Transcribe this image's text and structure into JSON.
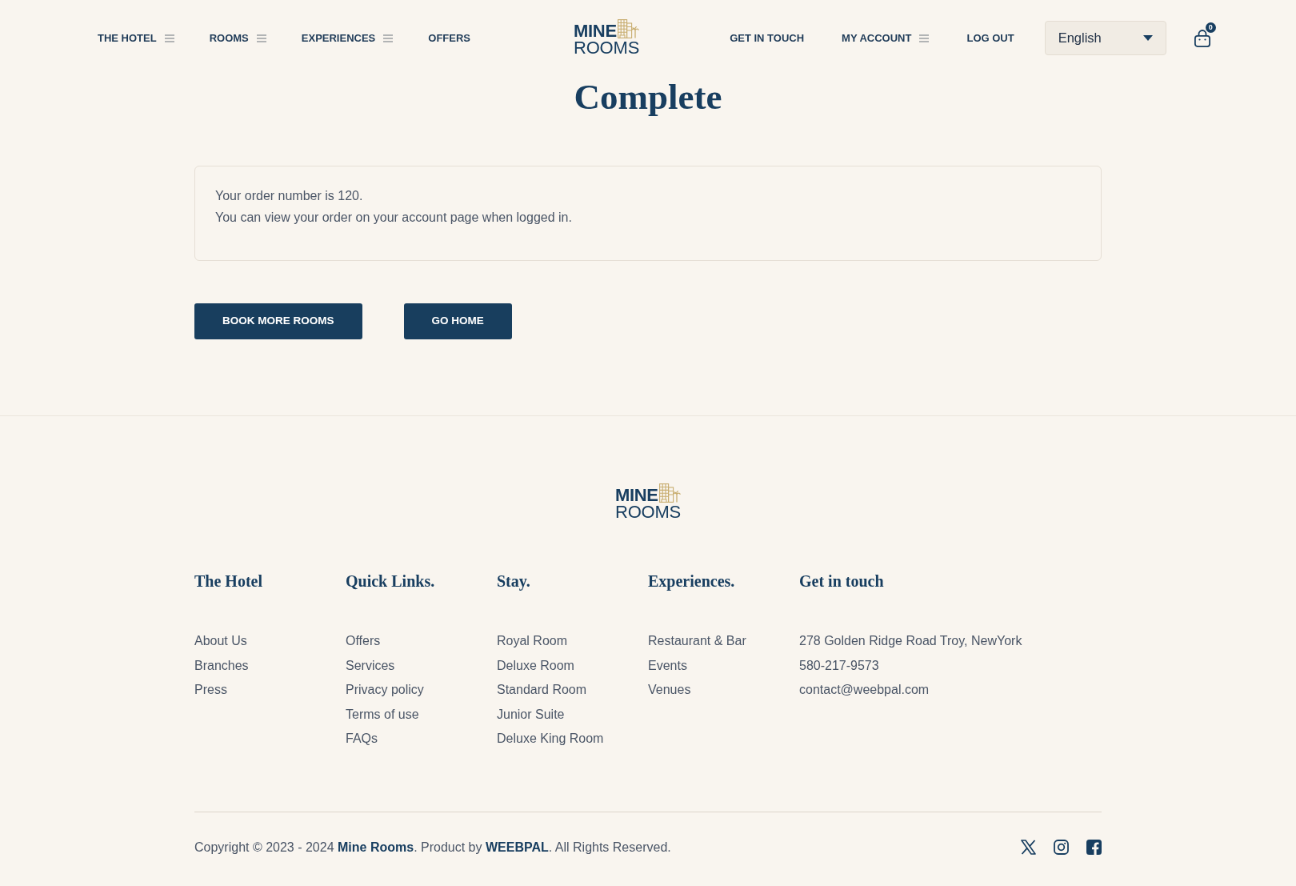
{
  "header": {
    "nav_left": [
      {
        "label": "THE HOTEL",
        "kind": "dropdown"
      },
      {
        "label": "ROOMS",
        "kind": "dropdown"
      },
      {
        "label": "EXPERIENCES",
        "kind": "dropdown"
      },
      {
        "label": "OFFERS",
        "kind": "link"
      }
    ],
    "logo": {
      "line_1": "MINE",
      "line_2": "ROOMS"
    },
    "nav_right": [
      {
        "label": "GET IN TOUCH",
        "kind": "link"
      },
      {
        "label": "MY ACCOUNT",
        "kind": "dropdown"
      },
      {
        "label": "LOG OUT",
        "kind": "link"
      }
    ],
    "language_select": {
      "value": "English"
    },
    "cart": {
      "count": "0"
    }
  },
  "page_title": "Complete",
  "message": {
    "lines": [
      "Your order number is 120.",
      "You can view your order on your account page when logged in."
    ]
  },
  "buttons": [
    "BOOK MORE ROOMS",
    "GO HOME"
  ],
  "footer": {
    "logo": {
      "line_1": "MINE",
      "line_2": "ROOMS"
    },
    "columns": [
      {
        "heading": "The Hotel",
        "links": [
          "About Us",
          "Branches",
          "Press"
        ]
      },
      {
        "heading": "Quick Links.",
        "links": [
          "Offers",
          "Services",
          "Privacy policy",
          "Terms of use",
          "FAQs"
        ]
      },
      {
        "heading": "Stay.",
        "links": [
          "Royal Room",
          "Deluxe Room",
          "Standard Room",
          "Junior Suite",
          "Deluxe King Room"
        ]
      },
      {
        "heading": "Experiences.",
        "links": [
          "Restaurant & Bar",
          "Events",
          "Venues"
        ]
      },
      {
        "heading": "Get in touch",
        "links": [
          "278 Golden Ridge Road Troy, NewYork",
          "580-217-9573",
          "contact@weebpal.com"
        ]
      }
    ],
    "copyright": "Copyright © 2023 - 2024 **Mine Rooms**. Product by **WEEBPAL**. All Rights Reserved."
  }
}
